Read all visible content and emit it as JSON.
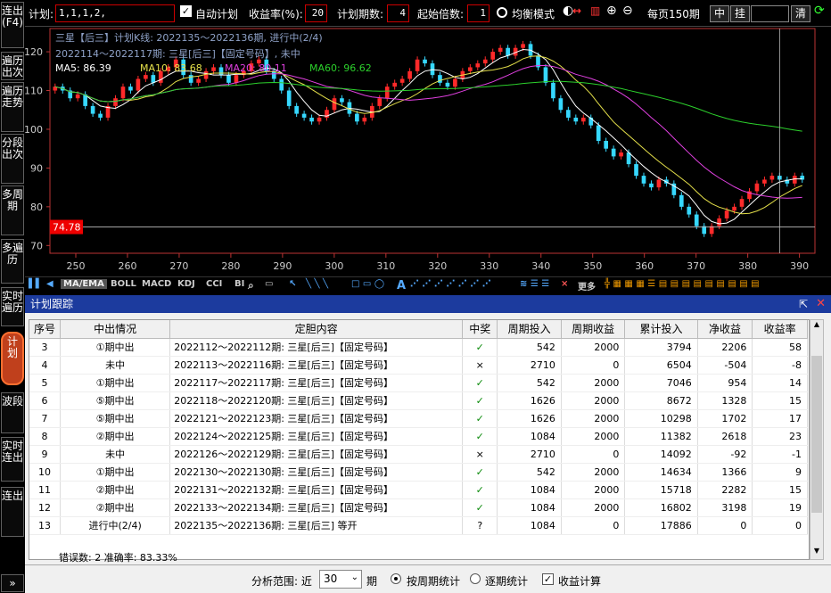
{
  "sidebar": [
    {
      "name": "sidebar-lianchu",
      "label": "连出(F4)"
    },
    {
      "name": "sidebar-bianliechuci",
      "label": "遍历出次"
    },
    {
      "name": "sidebar-bianliezoushi",
      "label": "遍历走势"
    },
    {
      "name": "sidebar-fenduanchuci",
      "label": "分段出次"
    },
    {
      "name": "sidebar-duozhouqi",
      "label": "多周期"
    },
    {
      "name": "sidebar-duobianli",
      "label": "多遍历"
    },
    {
      "name": "sidebar-shishibianli",
      "label": "实时遍历"
    },
    {
      "name": "sidebar-jihua",
      "label": "计划"
    },
    {
      "name": "sidebar-boduan",
      "label": "波段"
    },
    {
      "name": "sidebar-shishilianchu",
      "label": "实时连出"
    },
    {
      "name": "sidebar-lianchu2",
      "label": "连出"
    }
  ],
  "topbar": {
    "plan_label": "计划:",
    "plan_value": "1,1,1,2,",
    "auto_plan_label": "自动计划",
    "yield_label": "收益率(%):",
    "yield_value": "20",
    "periods_label": "计划期数:",
    "periods_value": "4",
    "start_mult_label": "起始倍数:",
    "start_mult_value": "1",
    "balance_label": "均衡模式",
    "per_page_label": "每页150期",
    "btn_zhong": "中",
    "btn_gua": "挂",
    "btn_qing": "清"
  },
  "chart": {
    "title": "三星【后三】计划K线:  2022135～2022136期, 进行中(2/4)",
    "subtitle": "2022114～2022117期: 三星[后三]【固定号码】, 未中",
    "ma5_label": "MA5: 86.39",
    "ma10_label": "MA10: 83.68",
    "ma20_label": "MA20: 80.11",
    "ma60_label": "MA60: 96.62",
    "current_value": "74.78",
    "y_ticks": [
      "120",
      "110",
      "100",
      "90",
      "80",
      "70"
    ],
    "x_ticks": [
      "250",
      "260",
      "270",
      "280",
      "290",
      "300",
      "310",
      "320",
      "330",
      "340",
      "350",
      "360",
      "370",
      "380",
      "390"
    ],
    "colors": {
      "up": "#ff2a2a",
      "down": "#36d8ff",
      "ma5": "#ffffff",
      "ma10": "#e5e04a",
      "ma20": "#e040e0",
      "ma60": "#2cd02c"
    }
  },
  "chart_data": {
    "type": "candlestick",
    "title": "三星【后三】计划K线",
    "x_range": [
      245,
      393
    ],
    "ylim": [
      68,
      126
    ],
    "closes": [
      111,
      110,
      108,
      109,
      106,
      104,
      103,
      106,
      108,
      111,
      110,
      113,
      114,
      112,
      115,
      116,
      118,
      114,
      112,
      113,
      115,
      116,
      114,
      112,
      114,
      115,
      117,
      118,
      115,
      113,
      110,
      106,
      104,
      103,
      102,
      103,
      105,
      108,
      107,
      104,
      102,
      103,
      106,
      108,
      111,
      112,
      113,
      115,
      118,
      117,
      114,
      112,
      111,
      113,
      115,
      116,
      117,
      118,
      120,
      121,
      119,
      121,
      122,
      119,
      116,
      112,
      108,
      105,
      103,
      102,
      103,
      101,
      97,
      95,
      93,
      94,
      91,
      88,
      86,
      85,
      87,
      86,
      83,
      80,
      78,
      75,
      73,
      75,
      77,
      79,
      80,
      82,
      84,
      86,
      87,
      88,
      87,
      86,
      88,
      87
    ],
    "ma_values": {
      "ma5": "86.39",
      "ma10": "83.68",
      "ma20": "80.11",
      "ma60": "96.62"
    }
  },
  "toolbar": {
    "ma_ema": "MA/EMA",
    "boll": "BOLL",
    "macd": "MACD",
    "kdj": "KDJ",
    "cci": "CCI",
    "bi": "BI",
    "more": "更多"
  },
  "panel": {
    "title": "计划跟踪",
    "columns": [
      "序号",
      "中出情况",
      "定胆内容",
      "中奖",
      "周期投入",
      "周期收益",
      "累计投入",
      "净收益",
      "收益率"
    ],
    "rows": [
      {
        "no": "3",
        "status": "①期中出",
        "plan": "2022112～2022112期: 三星[后三]【固定号码】",
        "win": "✓",
        "invest": "542",
        "income": "2000",
        "total": "3794",
        "net": "2206",
        "rate": "58"
      },
      {
        "no": "4",
        "status": "未中",
        "plan": "2022113～2022116期: 三星[后三]【固定号码】",
        "win": "×",
        "invest": "2710",
        "income": "0",
        "total": "6504",
        "net": "-504",
        "rate": "-8"
      },
      {
        "no": "5",
        "status": "①期中出",
        "plan": "2022117～2022117期: 三星[后三]【固定号码】",
        "win": "✓",
        "invest": "542",
        "income": "2000",
        "total": "7046",
        "net": "954",
        "rate": "14"
      },
      {
        "no": "6",
        "status": "⑤期中出",
        "plan": "2022118～2022120期: 三星[后三]【固定号码】",
        "win": "✓",
        "invest": "1626",
        "income": "2000",
        "total": "8672",
        "net": "1328",
        "rate": "15"
      },
      {
        "no": "7",
        "status": "⑤期中出",
        "plan": "2022121～2022123期: 三星[后三]【固定号码】",
        "win": "✓",
        "invest": "1626",
        "income": "2000",
        "total": "10298",
        "net": "1702",
        "rate": "17"
      },
      {
        "no": "8",
        "status": "②期中出",
        "plan": "2022124～2022125期: 三星[后三]【固定号码】",
        "win": "✓",
        "invest": "1084",
        "income": "2000",
        "total": "11382",
        "net": "2618",
        "rate": "23"
      },
      {
        "no": "9",
        "status": "未中",
        "plan": "2022126～2022129期: 三星[后三]【固定号码】",
        "win": "×",
        "invest": "2710",
        "income": "0",
        "total": "14092",
        "net": "-92",
        "rate": "-1"
      },
      {
        "no": "10",
        "status": "①期中出",
        "plan": "2022130～2022130期: 三星[后三]【固定号码】",
        "win": "✓",
        "invest": "542",
        "income": "2000",
        "total": "14634",
        "net": "1366",
        "rate": "9"
      },
      {
        "no": "11",
        "status": "②期中出",
        "plan": "2022131～2022132期: 三星[后三]【固定号码】",
        "win": "✓",
        "invest": "1084",
        "income": "2000",
        "total": "15718",
        "net": "2282",
        "rate": "15"
      },
      {
        "no": "12",
        "status": "②期中出",
        "plan": "2022133～2022134期: 三星[后三]【固定号码】",
        "win": "✓",
        "invest": "1084",
        "income": "2000",
        "total": "16802",
        "net": "3198",
        "rate": "19"
      },
      {
        "no": "13",
        "status": "进行中(2/4)",
        "plan": "2022135～2022136期: 三星[后三]      等开",
        "win": "?",
        "invest": "1084",
        "income": "0",
        "total": "17886",
        "net": "0",
        "rate": "0"
      }
    ],
    "summary": "错误数: 2  准确率: 83.33%",
    "range_label": "分析范围: 近",
    "range_value": "30",
    "range_unit": "期",
    "by_cycle": "按周期统计",
    "by_period": "逐期统计",
    "income_calc": "收益计算"
  }
}
